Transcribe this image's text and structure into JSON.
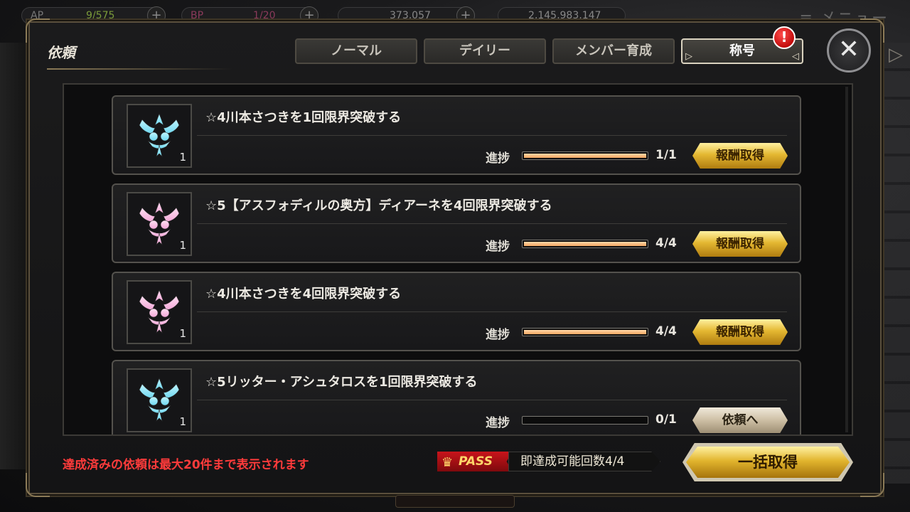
{
  "topbar": {
    "ap_label": "AP",
    "ap_value": "9/575",
    "bp_label": "BP",
    "bp_value": "1/20",
    "res3_value": "373,057",
    "res4_value": "2,145,983,147",
    "menu_label": "メニュー"
  },
  "modal": {
    "title": "依頼",
    "tabs": [
      {
        "label": "ノーマル",
        "active": false
      },
      {
        "label": "デイリー",
        "active": false
      },
      {
        "label": "メンバー育成",
        "active": false
      },
      {
        "label": "称号",
        "active": true
      }
    ],
    "alert_mark": "!",
    "close_label": "✕"
  },
  "quests": [
    {
      "name": "☆4川本さつきを1回限界突破する",
      "reward_count": "1",
      "emblem_color": "blue",
      "progress_label": "進捗",
      "progress_text": "1/1",
      "progress": 1.0,
      "button": "報酬取得",
      "button_style": "gold"
    },
    {
      "name": "☆5【アスフォディルの奥方】ディアーネを4回限界突破する",
      "reward_count": "1",
      "emblem_color": "pink",
      "progress_label": "進捗",
      "progress_text": "4/4",
      "progress": 1.0,
      "button": "報酬取得",
      "button_style": "gold"
    },
    {
      "name": "☆4川本さつきを4回限界突破する",
      "reward_count": "1",
      "emblem_color": "pink",
      "progress_label": "進捗",
      "progress_text": "4/4",
      "progress": 1.0,
      "button": "報酬取得",
      "button_style": "gold"
    },
    {
      "name": "☆5リッター・アシュタロスを1回限界突破する",
      "reward_count": "1",
      "emblem_color": "blue",
      "progress_label": "進捗",
      "progress_text": "0/1",
      "progress": 0.0,
      "button": "依頼へ",
      "button_style": "grey"
    }
  ],
  "footer": {
    "notice": "達成済みの依頼は最大20件まで表示されます",
    "pass_label": "PASS",
    "pass_text": "即達成可能回数4/4",
    "bulk_button": "一括取得"
  },
  "colors": {
    "gold_button": "#e4b832",
    "notice_red": "#ff3b3b",
    "progress_fill": "#f0a560",
    "emblem_blue": "#6fd8f0",
    "emblem_pink": "#f4a6d8"
  }
}
